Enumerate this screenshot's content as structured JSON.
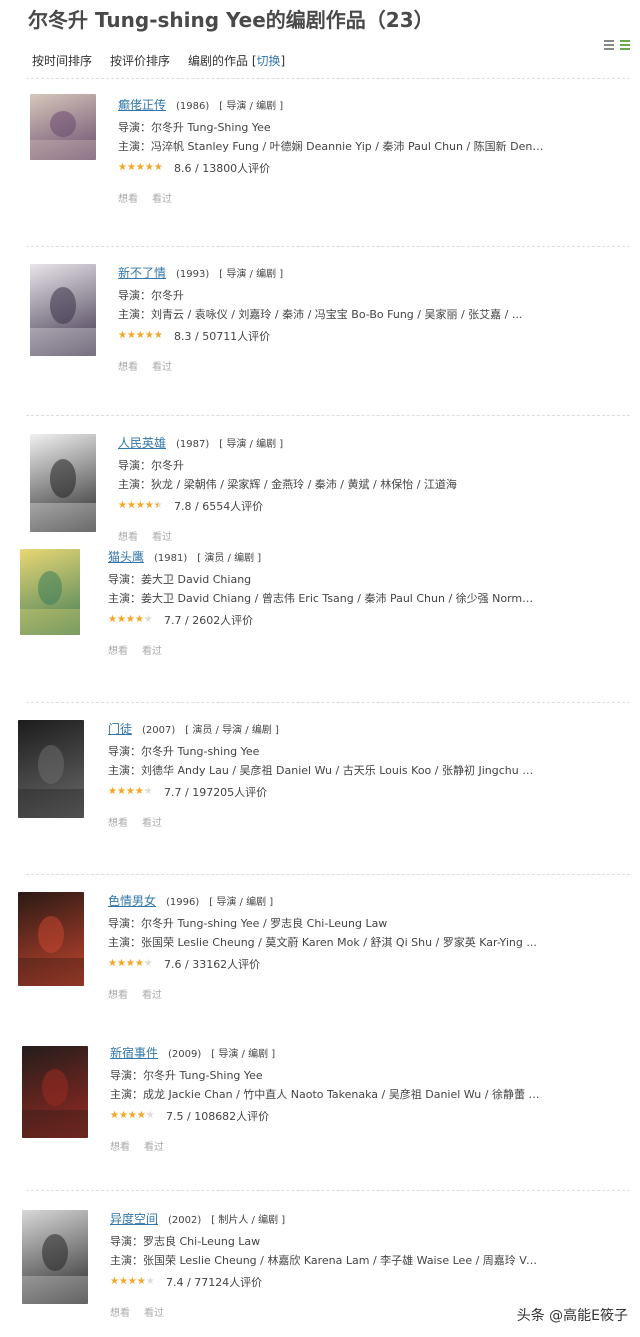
{
  "header": {
    "title": "尔冬升 Tung-shing Yee的编剧作品（23）"
  },
  "sort": {
    "by_time": "按时间排序",
    "by_rating": "按评价排序",
    "works_label": "编剧的作品 [",
    "switch": "切换",
    "close": "]"
  },
  "actions": {
    "want": "想看",
    "seen": "看过"
  },
  "movies": [
    {
      "title": "癫佬正传",
      "year": "(1986)",
      "roles": "[ 导演 / 编剧 ]",
      "director": "导演：尔冬升 Tung-Shing Yee",
      "cast": "主演：冯淬帆 Stanley Fung / 叶德娴 Deannie Yip / 秦沛 Paul Chun / 陈国新 Denni...",
      "rating_text": "8.6 / 13800人评价",
      "stars": 0.9,
      "poster_colors": [
        "#d6c7ba",
        "#6a4b6f"
      ]
    },
    {
      "title": "新不了情",
      "year": "(1993)",
      "roles": "[ 导演 / 编剧 ]",
      "director": "导演：尔冬升",
      "cast": "主演：刘青云 / 袁咏仪 / 刘嘉玲 / 秦沛 / 冯宝宝 Bo-Bo Fung / 吴家丽 / 张艾嘉 / ...",
      "rating_text": "8.3 / 50711人评价",
      "stars": 0.85,
      "poster_colors": [
        "#e9e4ea",
        "#3a3148"
      ]
    },
    {
      "title": "人民英雄",
      "year": "(1987)",
      "roles": "[ 导演 / 编剧 ]",
      "director": "导演：尔冬升",
      "cast": "主演：狄龙 / 梁朝伟 / 梁家辉 / 金燕玲 / 秦沛 / 黄斌 / 林保怡 / 江道海",
      "rating_text": "7.8 / 6554人评价",
      "stars": 0.8,
      "poster_colors": [
        "#f1f1f1",
        "#222222"
      ]
    },
    {
      "title": "猫头鹰",
      "year": "(1981)",
      "roles": "[ 演员 / 编剧 ]",
      "director": "导演：姜大卫 David Chiang",
      "cast": "主演：姜大卫 David Chiang / 曾志伟 Eric Tsang / 秦沛 Paul Chun / 徐少强 Norman...",
      "rating_text": "7.7 / 2602人评价",
      "stars": 0.75,
      "poster_colors": [
        "#e9d774",
        "#3e7d59"
      ]
    },
    {
      "title": "门徒",
      "year": "(2007)",
      "roles": "[ 演员 / 导演 / 编剧 ]",
      "director": "导演：尔冬升 Tung-shing Yee",
      "cast": "主演：刘德华 Andy Lau / 吴彦祖 Daniel Wu / 古天乐 Louis Koo / 张静初 Jingchu Z...",
      "rating_text": "7.7 / 197205人评价",
      "stars": 0.75,
      "poster_colors": [
        "#1c1c1c",
        "#6b6b6b"
      ]
    },
    {
      "title": "色情男女",
      "year": "(1996)",
      "roles": "[ 导演 / 编剧 ]",
      "director": "导演：尔冬升 Tung-shing Yee / 罗志良 Chi-Leung Law",
      "cast": "主演：张国荣 Leslie Cheung / 莫文蔚 Karen Mok / 舒淇 Qi Shu / 罗家英 Kar-Ying ...",
      "rating_text": "7.6 / 33162人评价",
      "stars": 0.75,
      "poster_colors": [
        "#2a1a14",
        "#c5452f"
      ]
    },
    {
      "title": "新宿事件",
      "year": "(2009)",
      "roles": "[ 导演 / 编剧 ]",
      "director": "导演：尔冬升 Tung-Shing Yee",
      "cast": "主演：成龙 Jackie Chan / 竹中直人 Naoto Takenaka / 吴彦祖 Daniel Wu / 徐静蕾 J...",
      "rating_text": "7.5 / 108682人评价",
      "stars": 0.75,
      "poster_colors": [
        "#231d1b",
        "#9a2a22"
      ]
    },
    {
      "title": "异度空间",
      "year": "(2002)",
      "roles": "[ 制片人 / 编剧 ]",
      "director": "导演：罗志良 Chi-Leung Law",
      "cast": "主演：张国荣 Leslie Cheung / 林嘉欣 Karena Lam / 李子雄 Waise Lee / 周嘉玲 Val...",
      "rating_text": "7.4 / 77124人评价",
      "stars": 0.7,
      "poster_colors": [
        "#d8d8d8",
        "#262626"
      ]
    }
  ],
  "watermark": "头条 @高能E筱子"
}
